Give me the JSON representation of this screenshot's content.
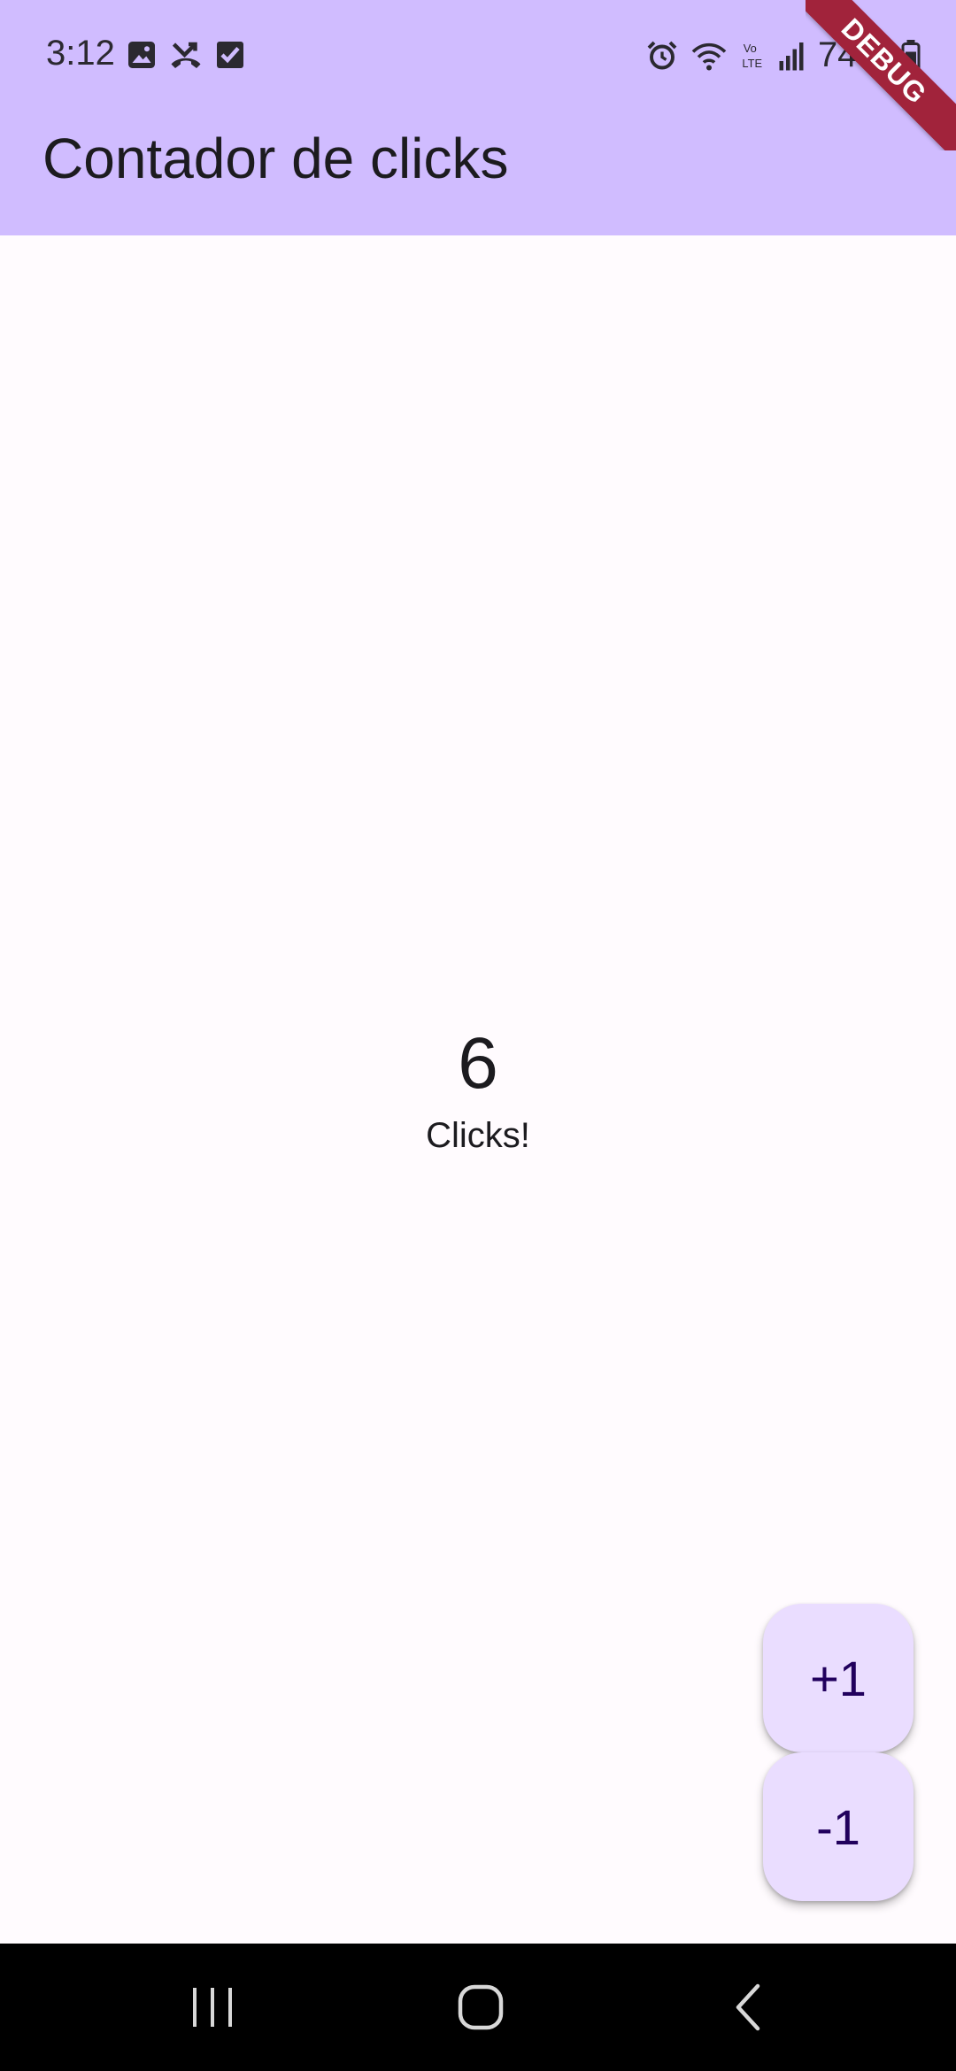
{
  "status_bar": {
    "time": "3:12",
    "battery": "74%",
    "left_icons": [
      "image-icon",
      "missed-call-icon",
      "checkbox-icon"
    ],
    "right_icons": [
      "alarm-icon",
      "wifi-icon",
      "volte-icon",
      "signal-icon",
      "battery-icon"
    ]
  },
  "app_bar": {
    "title": "Contador de clicks",
    "color": "#d0bcff"
  },
  "debug_banner": {
    "label": "DEBUG",
    "color": "#a1233b"
  },
  "counter": {
    "value": "6",
    "label": "Clicks!"
  },
  "fabs": {
    "increment_label": "+1",
    "decrement_label": "-1",
    "color": "#eaddff"
  },
  "nav_bar": {
    "buttons": [
      "recents-icon",
      "home-icon",
      "back-icon"
    ]
  },
  "colors": {
    "background": "#fffbfe",
    "text": "#1c1b1f",
    "fab_text": "#21005d"
  }
}
